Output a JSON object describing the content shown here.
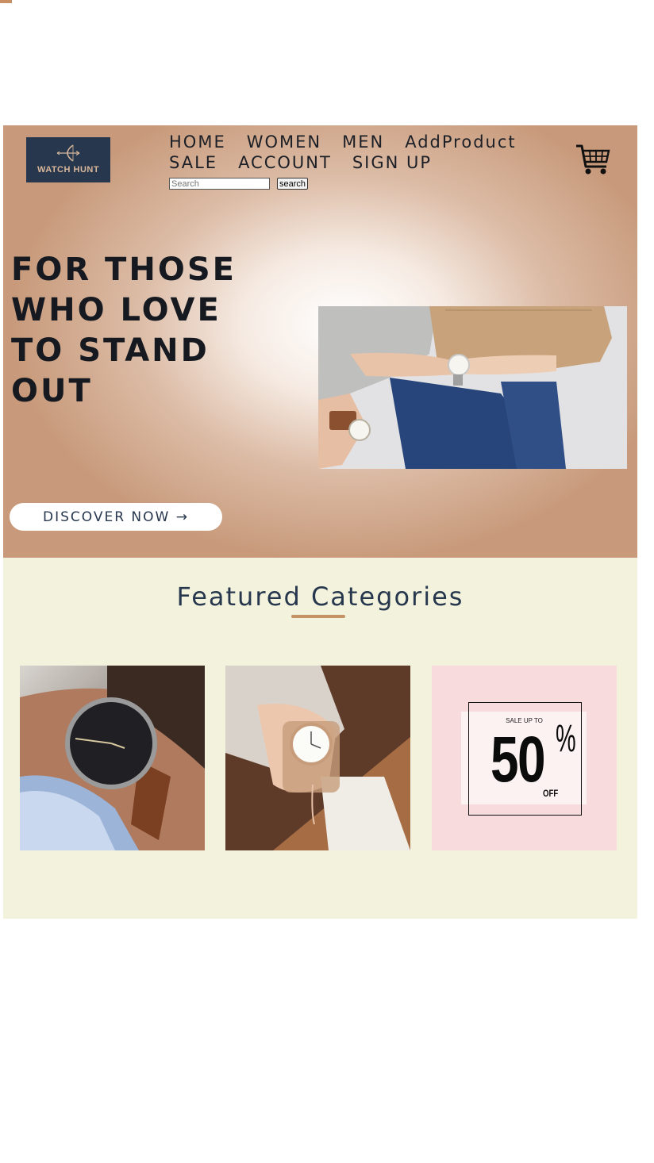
{
  "brand": {
    "name": "WATCH HUNT",
    "logo_icon": "bow-arrow-icon",
    "accent": "#c49468",
    "navy": "#27374d"
  },
  "nav": {
    "row1": [
      "HOME",
      "WOMEN",
      "MEN",
      "AddProduct"
    ],
    "row2": [
      "SALE",
      "ACCOUNT",
      "SIGN UP"
    ]
  },
  "search": {
    "placeholder": "Search",
    "button_label": "search"
  },
  "cart": {
    "icon": "shopping-cart-icon"
  },
  "hero": {
    "headline": "FOR THOSE WHO LOVE TO STAND OUT",
    "cta_label": "DISCOVER NOW →",
    "image": "couple-wearing-watches-photo"
  },
  "featured": {
    "title": "Featured Categories",
    "categories": [
      {
        "image": "mens-black-dial-watch-photo"
      },
      {
        "image": "womens-rose-gold-watch-photo"
      },
      {
        "image": "sale-banner",
        "kicker": "SALE UP TO",
        "amount": "50",
        "percent": "%",
        "suffix": "OFF"
      }
    ]
  },
  "colors": {
    "hero_edge": "#c89a7b",
    "featured_bg": "#f3f3dd",
    "sale_bg": "#f8dcdd"
  }
}
